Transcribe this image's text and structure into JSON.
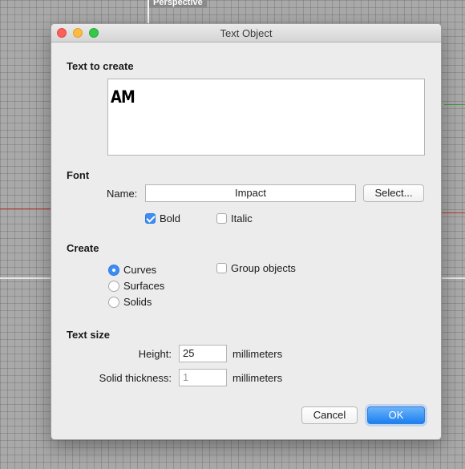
{
  "viewport": {
    "label": "Perspective"
  },
  "dialog": {
    "title": "Text Object",
    "text_to_create": {
      "heading": "Text to create",
      "value": "AM"
    },
    "font": {
      "heading": "Font",
      "name_label": "Name:",
      "name_value": "Impact",
      "select_button": "Select...",
      "bold_label": "Bold",
      "bold_checked": true,
      "italic_label": "Italic",
      "italic_checked": false
    },
    "create": {
      "heading": "Create",
      "options": [
        {
          "label": "Curves",
          "selected": true
        },
        {
          "label": "Surfaces",
          "selected": false
        },
        {
          "label": "Solids",
          "selected": false
        }
      ],
      "group_objects_label": "Group objects",
      "group_objects_checked": false
    },
    "text_size": {
      "heading": "Text size",
      "height_label": "Height:",
      "height_value": "25",
      "height_unit": "millimeters",
      "thickness_label": "Solid thickness:",
      "thickness_value": "1",
      "thickness_unit": "millimeters"
    },
    "buttons": {
      "cancel": "Cancel",
      "ok": "OK"
    }
  },
  "colors": {
    "accent": "#3d8df5",
    "ok_button": "#1b80f0",
    "window_bg": "#ececec"
  }
}
